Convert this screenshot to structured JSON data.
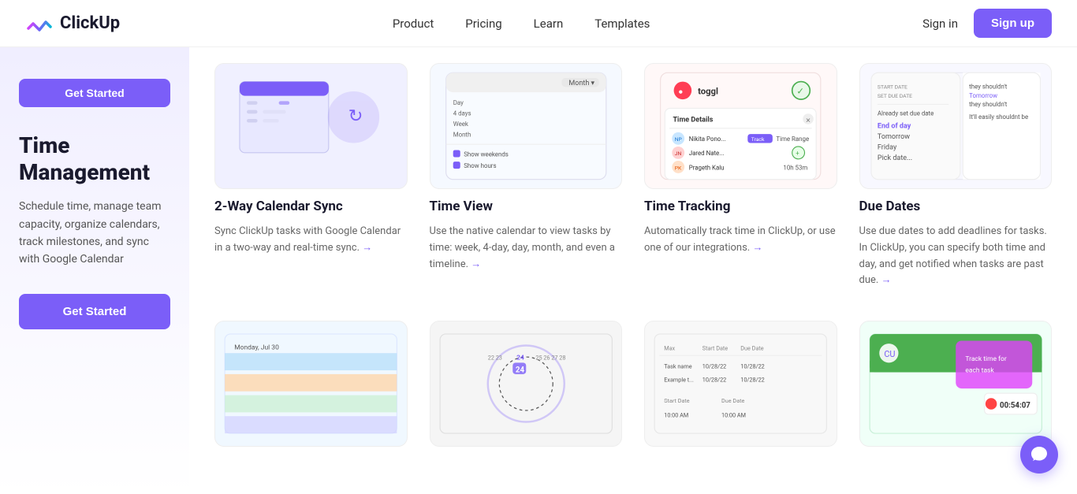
{
  "nav": {
    "logo_text": "ClickUp",
    "links": [
      {
        "id": "product",
        "label": "Product"
      },
      {
        "id": "pricing",
        "label": "Pricing"
      },
      {
        "id": "learn",
        "label": "Learn"
      },
      {
        "id": "templates",
        "label": "Templates"
      }
    ],
    "signin_label": "Sign in",
    "signup_label": "Sign up"
  },
  "sidebar": {
    "hero_btn_label": "Get Started",
    "title": "Time Management",
    "desc": "Schedule time, manage team capacity, organize calendars, track milestones, and sync with Google Calendar",
    "cta_label": "Get Started"
  },
  "features_row1": [
    {
      "id": "two-way-calendar-sync",
      "title": "2-Way Calendar Sync",
      "desc": "Sync ClickUp tasks with Google Calendar in a two-way and real-time sync.",
      "has_link": true
    },
    {
      "id": "time-view",
      "title": "Time View",
      "desc": "Use the native calendar to view tasks by time: week, 4-day, day, month, and even a timeline.",
      "has_link": true
    },
    {
      "id": "time-tracking",
      "title": "Time Tracking",
      "desc": "Automatically track time in ClickUp, or use one of our integrations.",
      "has_link": true
    },
    {
      "id": "due-dates",
      "title": "Due Dates",
      "desc": "Use due dates to add deadlines for tasks. In ClickUp, you can specify both time and day, and get notified when tasks are past due.",
      "has_link": true
    }
  ],
  "features_row2": [
    {
      "id": "box1",
      "title": "",
      "desc": ""
    },
    {
      "id": "box2",
      "title": "",
      "desc": ""
    },
    {
      "id": "box3",
      "title": "",
      "desc": ""
    },
    {
      "id": "box4",
      "title": "",
      "desc": ""
    }
  ],
  "colors": {
    "accent": "#7b5ef8",
    "text_dark": "#1a1a2e",
    "text_mid": "#555",
    "text_light": "#666"
  }
}
